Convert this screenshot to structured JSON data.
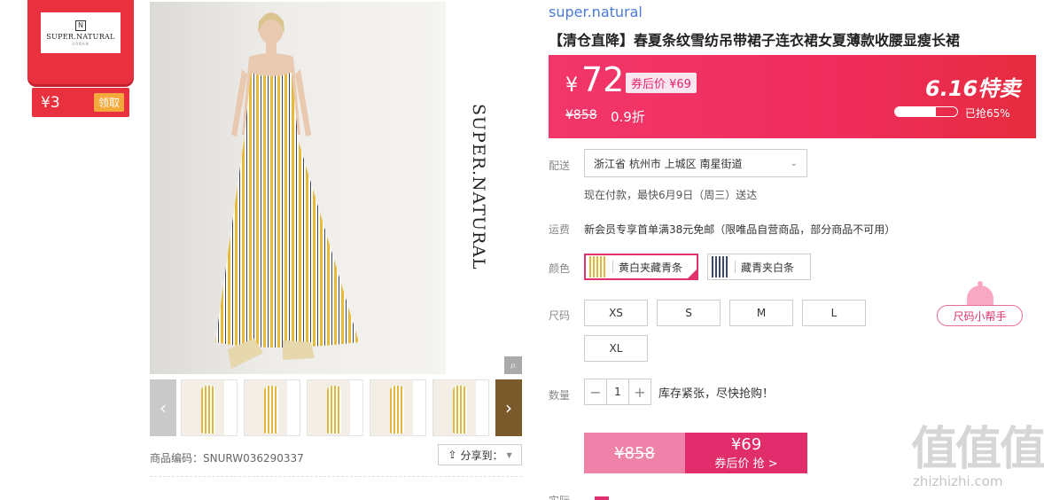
{
  "brand_badge": {
    "logo_name": "SUPER.NATURAL",
    "logo_sub": "URBAN",
    "coupon_amount": "¥3",
    "coupon_claim": "领取"
  },
  "gallery": {
    "vertical_brand": "SUPER.NATURAL",
    "thumb_count": 5
  },
  "product": {
    "brand": "super.natural",
    "title": "【清仓直降】春夏条纹雪纺吊带裙子连衣裙女夏薄款收腰显瘦长裙",
    "sku_label": "商品编码：SNURW036290337",
    "share_label": "分享到："
  },
  "price": {
    "currency": "¥",
    "current": "72",
    "after_coupon": "券后价 ¥69",
    "original": "¥858",
    "discount": "0.9折",
    "promo": "6.16特卖",
    "sold_text": "已抢65%",
    "sold_fraction": 0.65,
    "accent": "#ef2d5d"
  },
  "delivery": {
    "label": "配送",
    "address": "浙江省 杭州市 上城区 南星街道",
    "note": "现在付款，最快6月9日（周三）送达"
  },
  "shipping": {
    "label": "运费",
    "note": "新会员专享首单满38元免邮（限唯品自营商品，部分商品不可用）"
  },
  "colors": {
    "label": "颜色",
    "options": [
      "黄白夹藏青条",
      "藏青夹白条"
    ],
    "selected": 0
  },
  "sizes": {
    "label": "尺码",
    "options": [
      "XS",
      "S",
      "M",
      "L",
      "XL"
    ],
    "helper": "尺码小帮手"
  },
  "quantity": {
    "label": "数量",
    "value": "1",
    "minus": "−",
    "plus": "+",
    "stock_note": "库存紧张，尽快抢购！"
  },
  "buy": {
    "original": "¥858",
    "coupon_price": "¥69",
    "coupon_action": "券后价 抢 >"
  },
  "bottom": {
    "label": "实际"
  },
  "watermark": {
    "text": "值值值",
    "url": "zhizhizhi.com"
  }
}
